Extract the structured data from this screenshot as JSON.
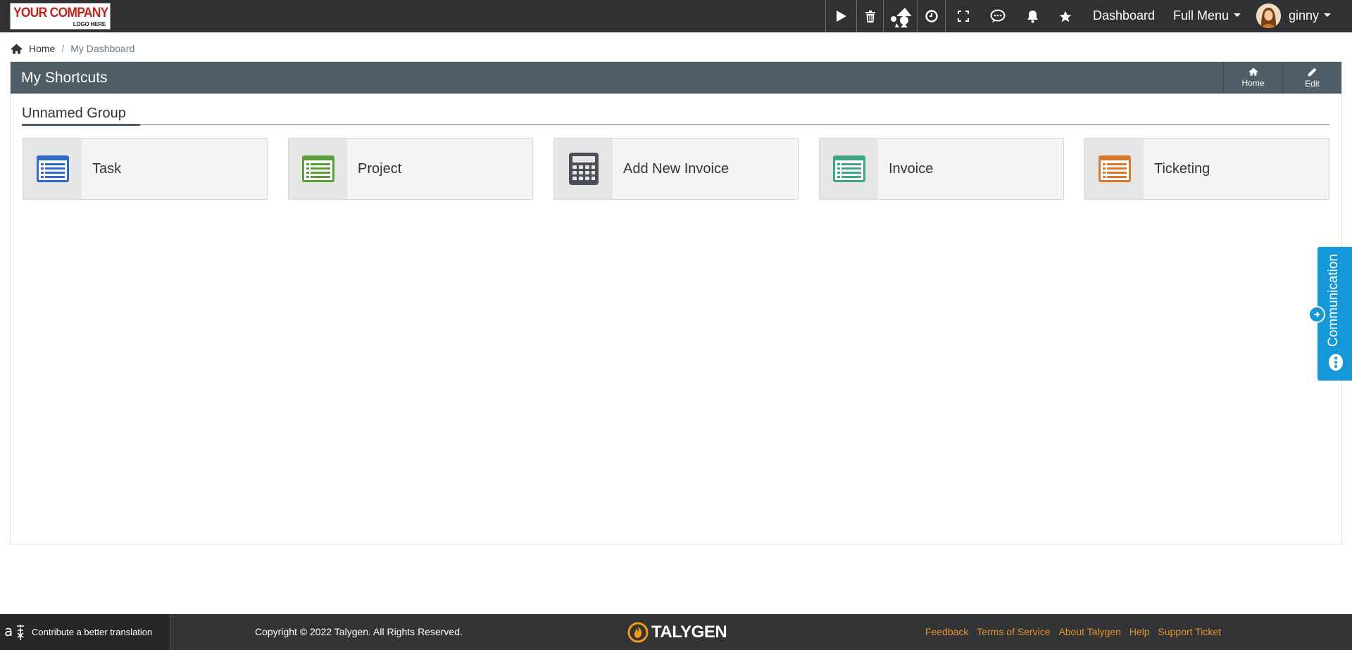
{
  "logo": {
    "line1": "YOUR COMPANY",
    "line2": "LOGO HERE"
  },
  "topbar": {
    "icons": [
      "play-icon",
      "trash-icon",
      "wizard-icon",
      "clock-icon",
      "fullscreen-icon",
      "chat-icon",
      "bell-icon",
      "star-icon"
    ],
    "dashboard_label": "Dashboard",
    "full_menu_label": "Full Menu",
    "user_name": "ginny"
  },
  "breadcrumb": {
    "home": "Home",
    "separator": "/",
    "current": "My Dashboard"
  },
  "panel": {
    "title": "My Shortcuts",
    "home_btn": "Home",
    "edit_btn": "Edit",
    "group_title": "Unnamed Group",
    "shortcuts": [
      {
        "label": "Task",
        "icon": "list-icon",
        "color": "#2d6bc4"
      },
      {
        "label": "Project",
        "icon": "list-icon",
        "color": "#5a9e3a"
      },
      {
        "label": "Add New Invoice",
        "icon": "calculator-icon",
        "color": "#4a4e57"
      },
      {
        "label": "Invoice",
        "icon": "list-icon",
        "color": "#3fa488"
      },
      {
        "label": "Ticketing",
        "icon": "list-icon",
        "color": "#d9772d"
      }
    ]
  },
  "communication": {
    "label": "Communication",
    "color": "#1697d8"
  },
  "footer": {
    "translate": "Contribute a better translation",
    "copyright": "Copyright © 2022 Talygen. All Rights Reserved.",
    "brand": "TALYGEN",
    "links": [
      "Feedback",
      "Terms of Service",
      "About Talygen",
      "Help",
      "Support Ticket"
    ],
    "link_color": "#e8912d"
  }
}
